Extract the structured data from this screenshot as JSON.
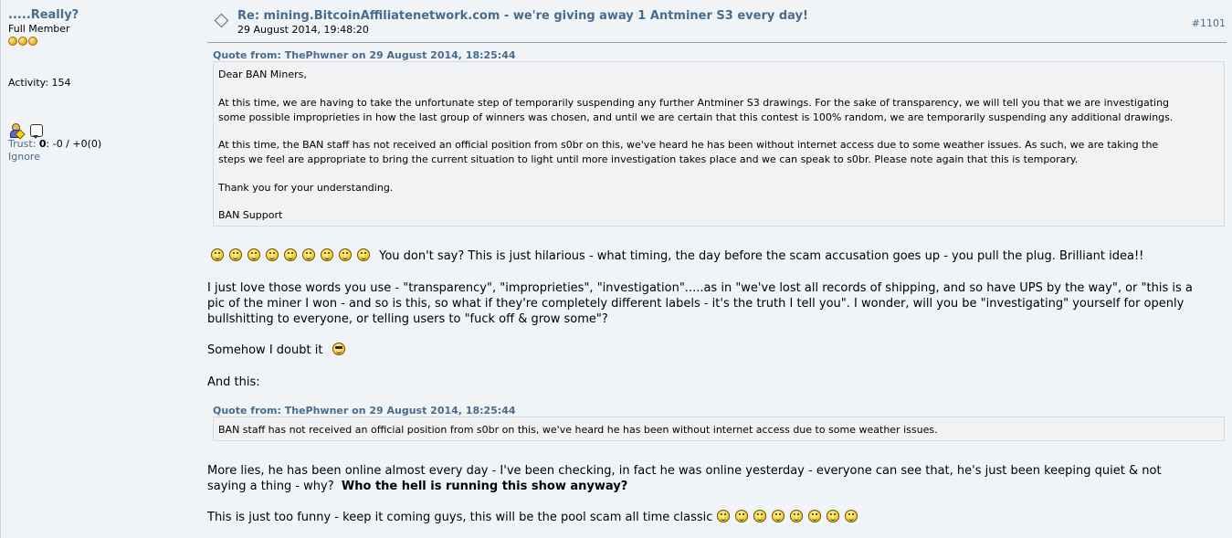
{
  "poster": {
    "name": ".....Really?",
    "rank": "Full Member",
    "activity": "Activity: 154",
    "trust_label": "Trust:",
    "trust_score": "0",
    "trust_detail": ": -0 / +0(0)",
    "ignore": "Ignore"
  },
  "post": {
    "subject": "Re: mining.BitcoinAffiliatenetwork.com - we're giving away 1 Antminer S3 every day!",
    "date": "29 August 2014, 19:48:20",
    "number": "#1101"
  },
  "quote1": {
    "header": "Quote from: ThePhwner on 29 August 2014, 18:25:44",
    "lines": [
      "Dear BAN Miners,",
      "At this time, we are having to take the unfortunate step of temporarily suspending any further Antminer S3 drawings. For the sake of transparency, we will tell you that we are investigating",
      "some possible improprieties in how the last group of winners was chosen, and until we are certain that this contest is 100% random, we are temporarily suspending any additional drawings.",
      "At this time, the BAN staff has not received an official position from s0br on this, we've heard he has been without internet access due to some weather issues. As such, we are taking the",
      "steps we feel are appropriate to bring the current situation to light until more investigation takes place and we can speak to s0br. Please note again that this is temporary.",
      "Thank you for your understanding.",
      "BAN Support"
    ]
  },
  "body": {
    "line1": "You don't say?  This is just hilarious - what timing, the day before the scam accusation goes up - you pull the plug. Brilliant idea!!",
    "para2_l1": "I just love those words you use - \"transparency\", \"improprieties\", \"investigation\".....as in \"we've lost all records of shipping, and so have UPS by the way\", or \"this is a",
    "para2_l2": "pic of the miner I won - and so is this, so what if they're completely different labels - it's the truth I tell you\".  I wonder, will you be \"investigating\" yourself for openly",
    "para2_l3": "bullshitting to everyone, or telling users to \"fuck off & grow some\"?",
    "doubt": "Somehow I doubt it",
    "and_this": "And this:",
    "para4_l1": "More lies, he has been online almost every day - I've been checking, in fact he was online yesterday - everyone can see that, he's just been keeping quiet & not",
    "para4_l2a": "saying a thing - why?",
    "para4_l2b": "Who the hell is running this show anyway?",
    "last": "This is just too funny - keep it coming guys, this will be the pool scam all time classic"
  },
  "quote2": {
    "header": "Quote from: ThePhwner on 29 August 2014, 18:25:44",
    "text": "BAN staff has not received an official position from s0br on this, we've heard he has been without internet access due to some weather issues."
  },
  "icons": {
    "smiley": "grin-smiley-icon",
    "cool": "cool-smiley-icon"
  }
}
